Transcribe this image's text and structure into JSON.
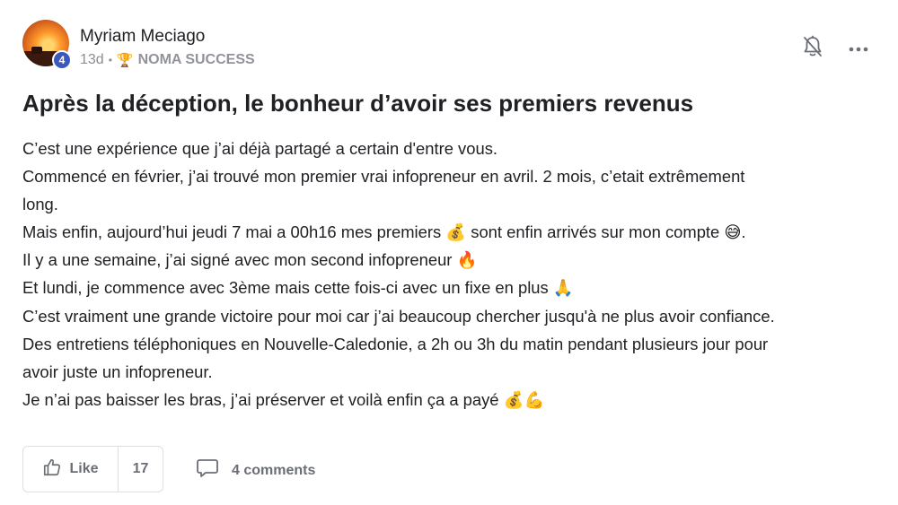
{
  "author": {
    "name": "Myriam Meciago",
    "level": "4"
  },
  "meta": {
    "time_ago": "13d",
    "separator": "•",
    "trophy_emoji": "🏆",
    "category": "NOMA SUCCESS"
  },
  "header_actions": {
    "bell_icon": "bell-outline",
    "more_icon": "three-dots-horizontal"
  },
  "post": {
    "title": "Après la déception, le bonheur d’avoir ses premiers revenus",
    "lines": [
      "C’est une expérience que j’ai déjà partagé a certain d'entre vous.",
      "Commencé en février, j’ai trouvé mon premier vrai infopreneur en avril. 2 mois, c’etait extrêmement",
      "long.",
      "Mais enfin, aujourd’hui jeudi 7 mai a 00h16 mes premiers 💰 sont enfin arrivés sur mon compte 😅.",
      "Il y a une semaine, j’ai signé avec mon second infopreneur 🔥",
      "Et lundi, je commence avec 3ème mais cette fois-ci avec un fixe en plus 🙏",
      "C’est vraiment une grande victoire pour moi car j’ai beaucoup chercher jusqu'à ne plus avoir confiance.",
      "Des entretiens téléphoniques en Nouvelle-Caledonie, a 2h ou 3h du matin pendant plusieurs jour pour",
      "avoir juste un infopreneur.",
      "Je n’ai pas baisser les bras, j’ai préserver et voilà enfin ça a payé 💰💪"
    ]
  },
  "actions": {
    "like_label": "Like",
    "like_count": "17",
    "comments_label": "4 comments",
    "like_icon": "thumbs-up-outline",
    "comment_icon": "speech-bubble-outline"
  },
  "colors": {
    "text": "#202124",
    "muted": "#8a8d91",
    "badge": "#3a58bd",
    "border": "#dedfe2"
  }
}
